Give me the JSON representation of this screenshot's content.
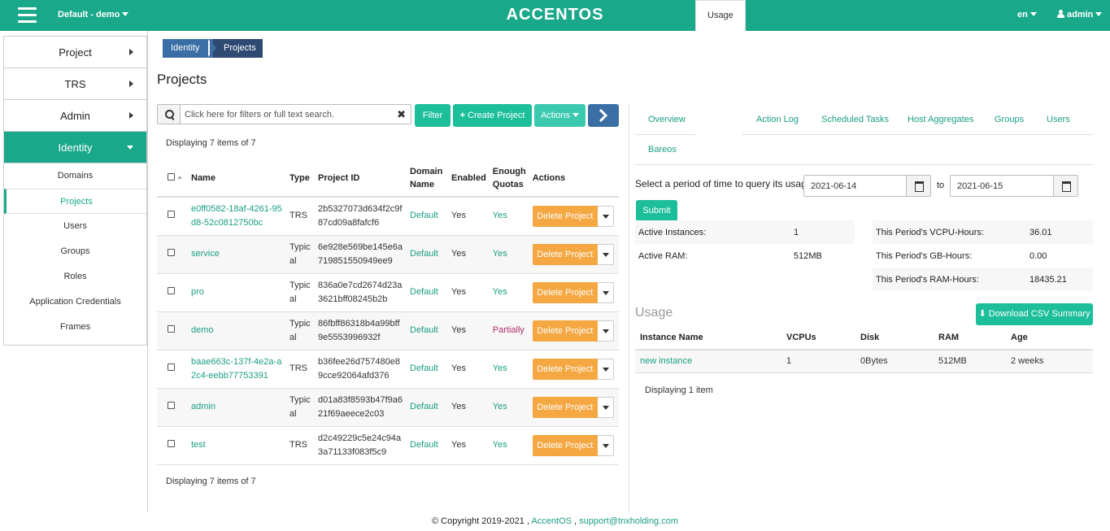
{
  "header": {
    "project_selector": "Default - demo",
    "logo": "ACCENTOS",
    "language": "en",
    "user": "admin"
  },
  "sidebar": {
    "main": [
      {
        "label": "Project"
      },
      {
        "label": "TRS"
      },
      {
        "label": "Admin"
      },
      {
        "label": "Identity"
      }
    ],
    "sub": [
      {
        "label": "Domains"
      },
      {
        "label": "Projects"
      },
      {
        "label": "Users"
      },
      {
        "label": "Groups"
      },
      {
        "label": "Roles"
      },
      {
        "label": "Application Credentials"
      },
      {
        "label": "Frames"
      }
    ]
  },
  "breadcrumb": [
    "Identity",
    "Projects"
  ],
  "page_title": "Projects",
  "toolbar": {
    "search_placeholder": "Click here for filters or full text search.",
    "clear": "✖",
    "filter": "Filter",
    "create": "Create Project",
    "actions": "Actions"
  },
  "projects": {
    "display_count": "Displaying 7 items of 7",
    "headers": {
      "name": "Name",
      "type": "Type",
      "project_id": "Project ID",
      "domain_name": "Domain Name",
      "enabled": "Enabled",
      "enough_quotas": "Enough Quotas",
      "actions": "Actions"
    },
    "delete_label": "Delete Project",
    "rows": [
      {
        "name": "e0ff0582-18af-4261-95d8-52c0812750bc",
        "type": "TRS",
        "id": "2b5327073d634f2c9f87cd09a8fafcf6",
        "domain": "Default",
        "enabled": "Yes",
        "quotas": "Yes"
      },
      {
        "name": "service",
        "type": "Typical",
        "id": "6e928e569be145e6a719851550949ee9",
        "domain": "Default",
        "enabled": "Yes",
        "quotas": "Yes"
      },
      {
        "name": "pro",
        "type": "Typical",
        "id": "836a0e7cd2674d23a3621bff08245b2b",
        "domain": "Default",
        "enabled": "Yes",
        "quotas": "Yes"
      },
      {
        "name": "demo",
        "type": "Typical",
        "id": "86fbff86318b4a99bff9e5553996932f",
        "domain": "Default",
        "enabled": "Yes",
        "quotas": "Partially"
      },
      {
        "name": "baae663c-137f-4e2a-a2c4-eebb77753391",
        "type": "TRS",
        "id": "b36fee26d757480e89cce92064afd376",
        "domain": "Default",
        "enabled": "Yes",
        "quotas": "Yes"
      },
      {
        "name": "admin",
        "type": "Typical",
        "id": "d01a83f8593b47f9a621f69aeece2c03",
        "domain": "Default",
        "enabled": "Yes",
        "quotas": "Yes"
      },
      {
        "name": "test",
        "type": "TRS",
        "id": "d2c49229c5e24c94a3a71133f083f5c9",
        "domain": "Default",
        "enabled": "Yes",
        "quotas": "Yes"
      }
    ]
  },
  "detail": {
    "tabs": [
      "Overview",
      "Usage",
      "Action Log",
      "Scheduled Tasks",
      "Host Aggregates",
      "Groups",
      "Users",
      "Bareos"
    ],
    "active_tab": "Usage",
    "query_label": "Select a period of time to query its usage:",
    "date_from": "2021-06-14",
    "to_label": "to",
    "date_to": "2021-06-15",
    "submit": "Submit",
    "stats_left": [
      {
        "label": "Active Instances:",
        "value": "1"
      },
      {
        "label": "Active RAM:",
        "value": "512MB"
      }
    ],
    "stats_right": [
      {
        "label": "This Period's VCPU-Hours:",
        "value": "36.01"
      },
      {
        "label": "This Period's GB-Hours:",
        "value": "0.00"
      },
      {
        "label": "This Period's RAM-Hours:",
        "value": "18435.21"
      }
    ],
    "usage_title": "Usage",
    "download": "Download CSV Summary",
    "usage_headers": [
      "Instance Name",
      "VCPUs",
      "Disk",
      "RAM",
      "Age"
    ],
    "usage_rows": [
      {
        "name": "new instance",
        "vcpus": "1",
        "disk": "0Bytes",
        "ram": "512MB",
        "age": "2 weeks"
      }
    ],
    "usage_count": "Displaying 1 item"
  },
  "footer": {
    "copyright": "© Copyright 2019-2021 ,",
    "brand": "AccentOS",
    "sep": ",",
    "email": "support@tnxholding.com"
  },
  "colors": {
    "primary": "#1aa88a",
    "delete": "#f5a742",
    "breadcrumb": "#3a6ea5"
  }
}
